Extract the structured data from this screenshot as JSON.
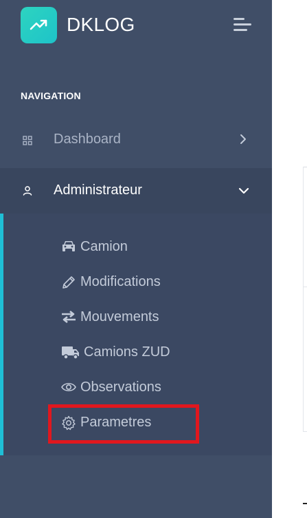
{
  "brand": {
    "name": "DKLOG",
    "accent": "#2dd4c0"
  },
  "nav": {
    "heading": "NAVIGATION",
    "items": [
      {
        "label": "Dashboard",
        "icon": "grid-icon",
        "state": "collapsed"
      },
      {
        "label": "Administrateur",
        "icon": "user-icon",
        "state": "expanded"
      }
    ],
    "submenu": [
      {
        "label": "Camion",
        "icon": "car-icon"
      },
      {
        "label": "Modifications",
        "icon": "pencil-icon"
      },
      {
        "label": "Mouvements",
        "icon": "exchange-arrows-icon"
      },
      {
        "label": "Camions ZUD",
        "icon": "truck-icon"
      },
      {
        "label": "Observations",
        "icon": "eye-icon"
      },
      {
        "label": "Parametres",
        "icon": "gear-icon"
      }
    ]
  },
  "colors": {
    "sidebar_bg": "#404e67",
    "active_indicator": "#1fbfd6",
    "highlight_box": "#e1171e"
  }
}
